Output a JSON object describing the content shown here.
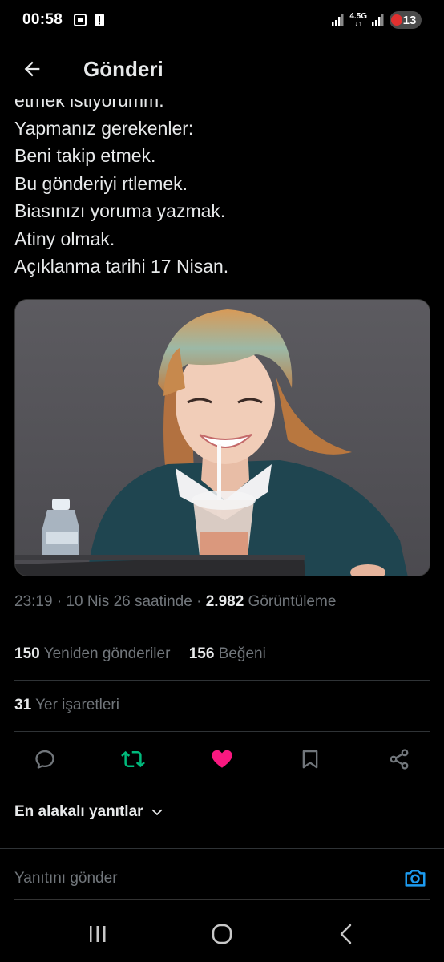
{
  "status_bar": {
    "time": "00:58",
    "network": "4.5G",
    "battery": "13",
    "icons": [
      "screenshot-icon",
      "alert-icon",
      "signal-icon",
      "signal-icon"
    ]
  },
  "header": {
    "title": "Gönderi",
    "back_icon": "arrow-left-icon"
  },
  "tweet": {
    "lines": [
      "etmek istiyorumm.",
      "Yapmanız gerekenler:",
      "Beni takip etmek.",
      "Bu gönderiyi rtlemek.",
      "Biasınızı yoruma yazmak.",
      "Atiny olmak.",
      "Açıklanma tarihi 17 Nisan."
    ],
    "time": "23:19",
    "sep1": " · ",
    "date": "10 Nis 26 saatinde",
    "sep2": " · ",
    "views_count": "2.982",
    "views_label": "Görüntüleme"
  },
  "stats": {
    "reposts_count": "150",
    "reposts_label": "Yeniden gönderiler",
    "likes_count": "156",
    "likes_label": "Beğeni",
    "bookmarks_count": "31",
    "bookmarks_label": "Yer işaretleri"
  },
  "actions": {
    "items": [
      "reply-icon",
      "retweet-icon",
      "heart-icon",
      "bookmark-icon",
      "share-icon"
    ],
    "retweet_color": "#00ba7c",
    "like_color": "#f91880",
    "icon_color": "#71767b"
  },
  "replies": {
    "sort_label": "En alakalı yanıtlar",
    "reply_placeholder": "Yanıtını gönder",
    "accent_color": "#1d9bf0"
  },
  "nav": {
    "items": [
      "recents-icon",
      "home-icon",
      "back-icon"
    ]
  }
}
